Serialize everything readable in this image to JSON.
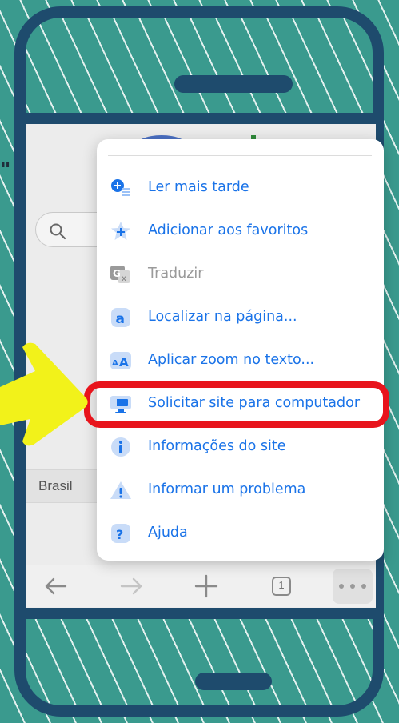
{
  "background": {
    "color": "#3a9a8e",
    "phone_frame_color": "#1e4b6d"
  },
  "overlay": {
    "quote_mark": "\""
  },
  "browser": {
    "region_label": "Brasil",
    "bottom_bar": {
      "back_icon": "back-arrow-icon",
      "forward_icon": "forward-arrow-icon",
      "new_tab_icon": "plus-icon",
      "tab_count": "1",
      "more_icon": "more-dots-icon"
    }
  },
  "menu": {
    "items": [
      {
        "label": "Ler mais tarde",
        "icon": "read-later-icon",
        "enabled": true
      },
      {
        "label": "Adicionar aos favoritos",
        "icon": "star-icon",
        "enabled": true
      },
      {
        "label": "Traduzir",
        "icon": "translate-icon",
        "enabled": false
      },
      {
        "label": "Localizar na página...",
        "icon": "find-in-page-icon",
        "enabled": true
      },
      {
        "label": "Aplicar zoom no texto...",
        "icon": "text-zoom-icon",
        "enabled": true
      },
      {
        "label": "Solicitar site para computador",
        "icon": "desktop-site-icon",
        "enabled": true,
        "highlighted": true
      },
      {
        "label": "Informações do site",
        "icon": "info-icon",
        "enabled": true
      },
      {
        "label": "Informar um problema",
        "icon": "warning-icon",
        "enabled": true
      },
      {
        "label": "Ajuda",
        "icon": "help-icon",
        "enabled": true
      }
    ]
  },
  "colors": {
    "accent": "#1a73e8",
    "highlight": "#e8141c",
    "arrow": "#f2f21a",
    "disabled": "#9a9a9a"
  }
}
